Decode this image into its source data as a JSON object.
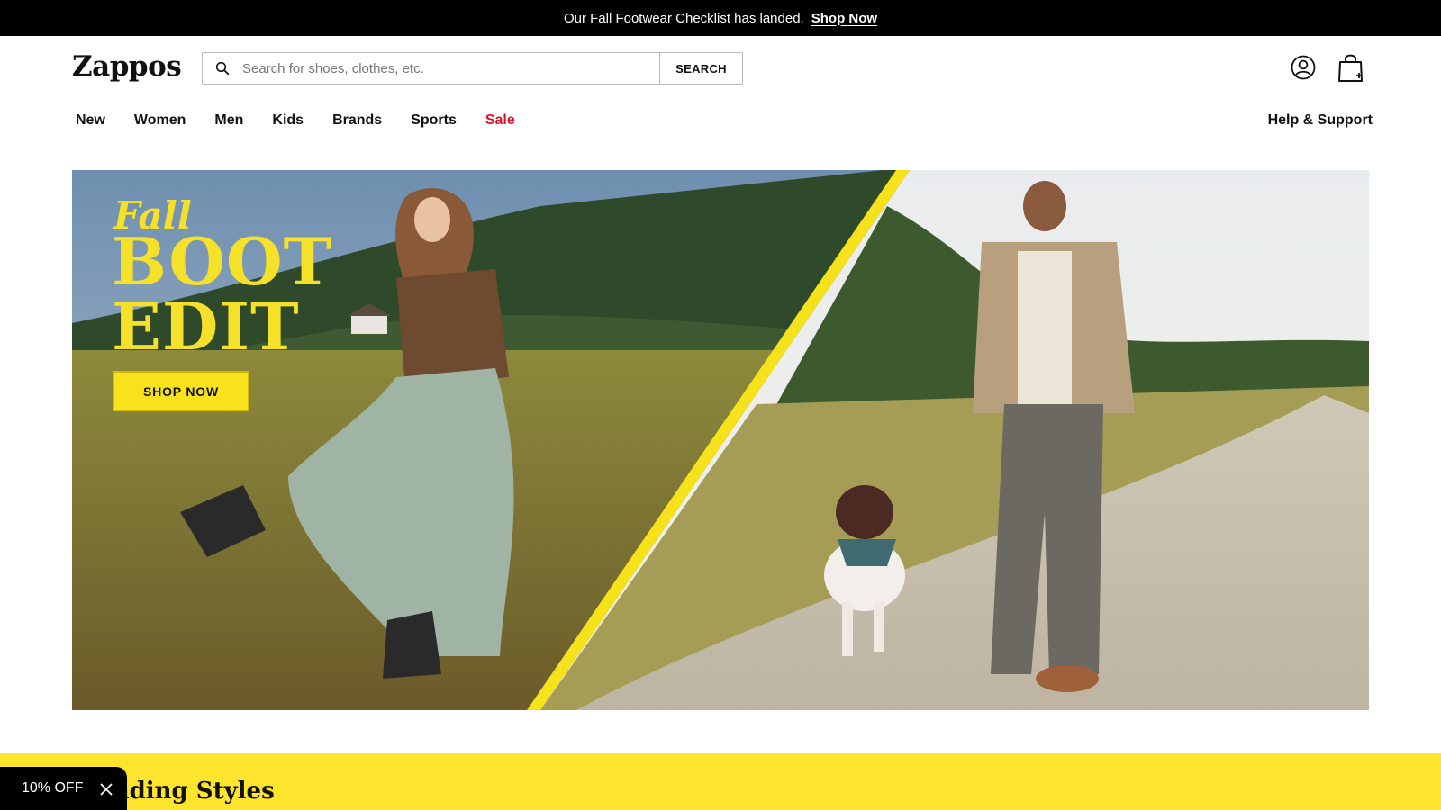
{
  "promo_bar": {
    "message": "Our Fall Footwear Checklist has landed.",
    "link": "Shop Now"
  },
  "header": {
    "logo": "Zappos",
    "search": {
      "placeholder": "Search for shoes, clothes, etc.",
      "button": "SEARCH"
    },
    "icons": [
      "account-icon",
      "shopping-bag-icon",
      "search-icon"
    ]
  },
  "nav": {
    "items": [
      {
        "label": "New"
      },
      {
        "label": "Women"
      },
      {
        "label": "Men"
      },
      {
        "label": "Kids"
      },
      {
        "label": "Brands"
      },
      {
        "label": "Sports"
      },
      {
        "label": "Sale"
      }
    ],
    "help": "Help & Support"
  },
  "hero": {
    "eyebrow": "Fall",
    "headline_1": "BOOT",
    "headline_2": "EDIT",
    "cta": "SHOP NOW"
  },
  "trending": {
    "title": "Trending Styles"
  },
  "discount_pill": {
    "label": "10% OFF"
  },
  "colors": {
    "accent_yellow": "#f7e21b",
    "sale_red": "#e0112b",
    "strip_yellow": "#fde42d",
    "promo_bar": "#000000"
  }
}
